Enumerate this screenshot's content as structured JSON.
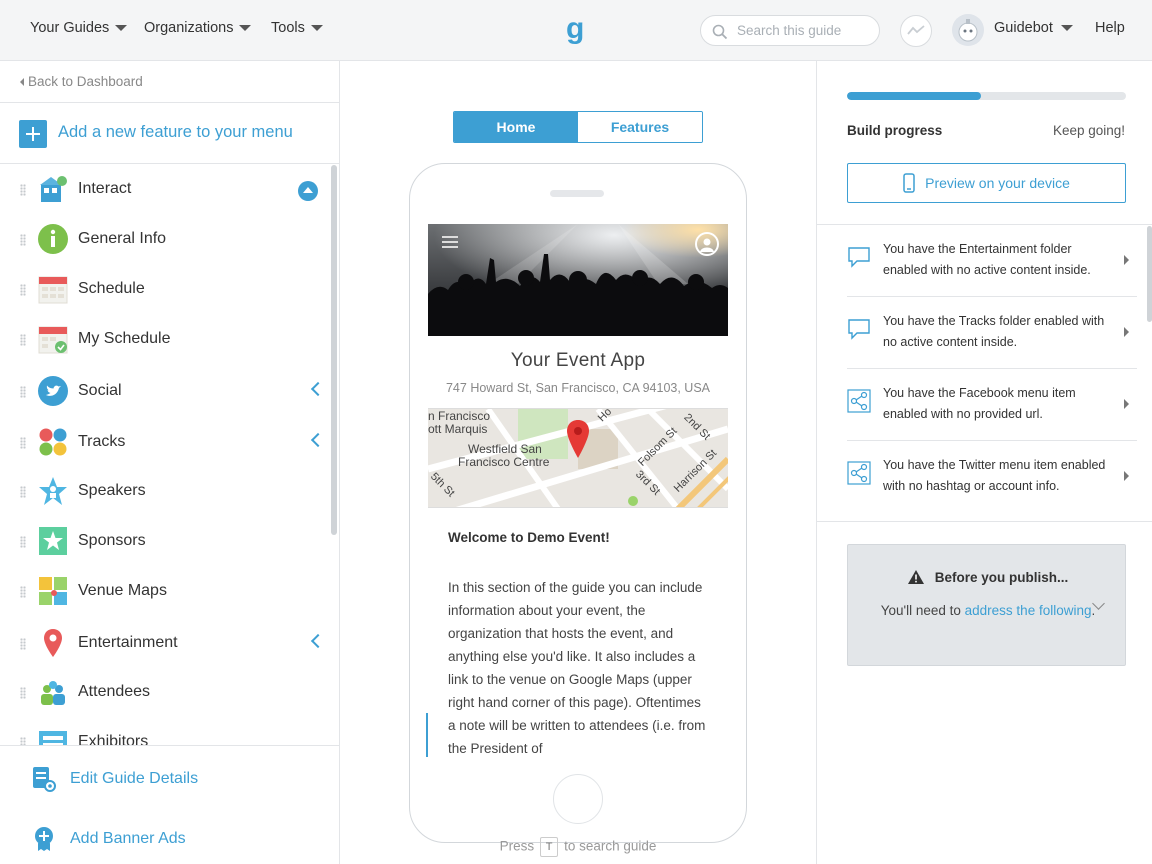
{
  "topnav": {
    "your_guides": "Your Guides",
    "organizations": "Organizations",
    "tools": "Tools",
    "logo": "g",
    "search_placeholder": "Search this guide",
    "user": "Guidebot",
    "help": "Help"
  },
  "sidebar": {
    "back": "Back to Dashboard",
    "add_feature": "Add a new feature to your menu",
    "items": [
      {
        "label": "Interact",
        "icon": "interact-icon"
      },
      {
        "label": "General Info",
        "icon": "info-icon"
      },
      {
        "label": "Schedule",
        "icon": "calendar-icon"
      },
      {
        "label": "My Schedule",
        "icon": "calendar-check-icon"
      },
      {
        "label": "Social",
        "icon": "twitter-icon"
      },
      {
        "label": "Tracks",
        "icon": "tracks-icon"
      },
      {
        "label": "Speakers",
        "icon": "speaker-star-icon"
      },
      {
        "label": "Sponsors",
        "icon": "sponsor-star-icon"
      },
      {
        "label": "Venue Maps",
        "icon": "map-icon"
      },
      {
        "label": "Entertainment",
        "icon": "pin-icon"
      },
      {
        "label": "Attendees",
        "icon": "people-icon"
      },
      {
        "label": "Exhibitors",
        "icon": "exhibitor-icon"
      }
    ],
    "edit_details": "Edit Guide Details",
    "add_banner": "Add Banner Ads"
  },
  "center": {
    "tabs": [
      "Home",
      "Features"
    ],
    "app_title": "Your Event App",
    "address": "747 Howard St, San Francisco, CA 94103, USA",
    "map_labels": [
      "n Francisco",
      "ott Marquis",
      "Westfield San",
      "Francisco Centre",
      "Folsom St",
      "2nd St",
      "Harrison St",
      "3rd St",
      "5th St",
      "Ho"
    ],
    "welcome": "Welcome to Demo Event!",
    "body": "In this section of the guide you can include information about your event, the organization that hosts the event, and anything else you'd like. It also includes a link to the venue on Google Maps (upper right hand corner of this page). Oftentimes a note will be written to attendees (i.e. from the President of",
    "hint_before": "Press",
    "hint_key": "T",
    "hint_after": "to search guide"
  },
  "right": {
    "progress": 0.48,
    "build_progress": "Build progress",
    "status": "Keep going!",
    "preview": "Preview on your device",
    "alerts": [
      {
        "text": "You have the Entertainment folder enabled with no active content inside.",
        "icon": "chat-bubble-icon"
      },
      {
        "text": "You have the Tracks folder enabled with no active content inside.",
        "icon": "chat-bubble-icon"
      },
      {
        "text": "You have the Facebook menu item enabled with no provided url.",
        "icon": "share-icon"
      },
      {
        "text": "You have the Twitter menu item enabled with no hashtag or account info.",
        "icon": "share-icon"
      }
    ],
    "publish": {
      "title": "Before you publish...",
      "before": "You'll need to",
      "link": "address the following",
      "after": "."
    }
  },
  "colors": {
    "accent": "#3d9fd3"
  }
}
